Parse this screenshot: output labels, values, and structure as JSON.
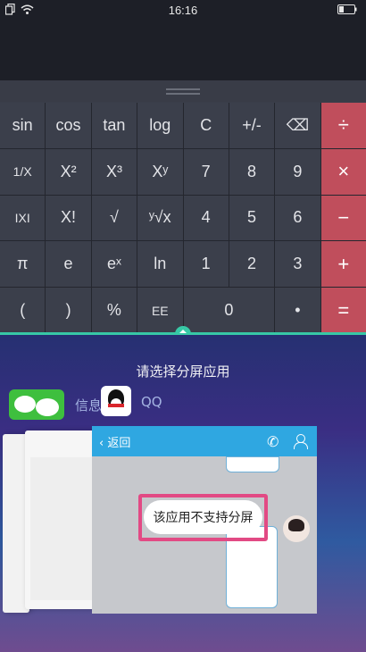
{
  "status_bar": {
    "time": "16:16"
  },
  "calculator": {
    "rows": [
      [
        "sin",
        "cos",
        "tan",
        "log",
        "C",
        "+/-",
        "⌫",
        "÷"
      ],
      [
        "1/X",
        "X²",
        "X³",
        "Xʸ",
        "7",
        "8",
        "9",
        "×"
      ],
      [
        "IXI",
        "X!",
        "√",
        "ʸ√x",
        "4",
        "5",
        "6",
        "−"
      ],
      [
        "π",
        "e",
        "eˣ",
        "ln",
        "1",
        "2",
        "3",
        "+"
      ],
      [
        "(",
        ")",
        "%",
        "EE",
        "0",
        "•",
        "="
      ]
    ]
  },
  "split_screen": {
    "title": "请选择分屏应用",
    "apps": [
      {
        "label": "信息",
        "icon": "wechat-icon"
      },
      {
        "label": "QQ",
        "icon": "qq-icon"
      }
    ],
    "preview": {
      "back_label": "返回",
      "toast": "该应用不支持分屏"
    }
  },
  "colors": {
    "operator": "#c04e5c",
    "divider": "#37c8a6",
    "toast_highlight": "#e24a84",
    "qq_header": "#2fa7e1"
  }
}
